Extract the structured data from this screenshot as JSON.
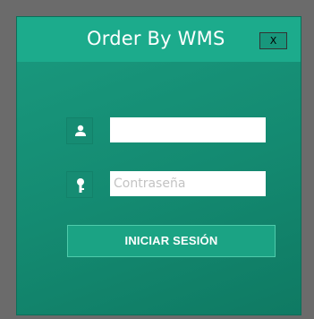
{
  "window": {
    "title": "Order By WMS",
    "close_label": "X"
  },
  "form": {
    "username": {
      "icon": "user-icon",
      "value": "",
      "placeholder": ""
    },
    "password": {
      "icon": "key-icon",
      "value": "",
      "placeholder": "Contraseña"
    },
    "submit_label": "INICIAR SESIÓN"
  },
  "colors": {
    "accent": "#1cab8c",
    "window_bg": "#148a71",
    "backdrop": "#6b6b6b"
  }
}
